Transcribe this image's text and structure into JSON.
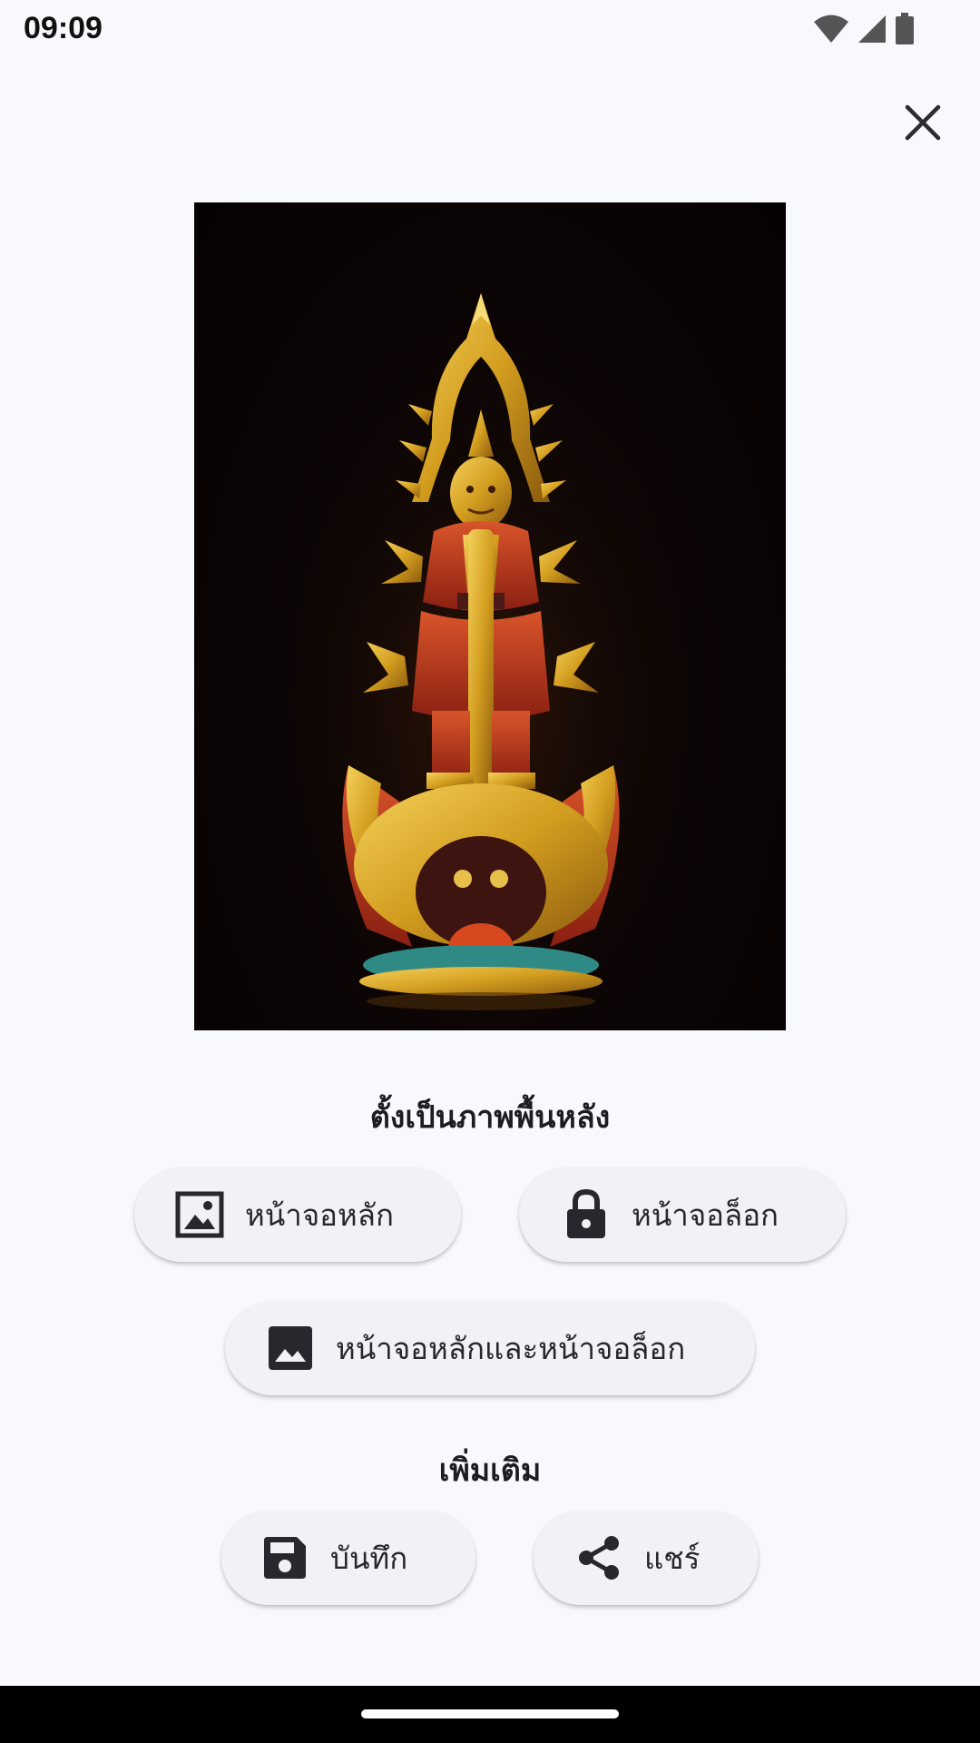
{
  "status_bar": {
    "time": "09:09",
    "icons": [
      "wifi-icon",
      "signal-icon",
      "battery-icon"
    ]
  },
  "header": {
    "close_icon": "close-icon"
  },
  "preview": {
    "description_icon": "wallpaper-preview-image"
  },
  "set_wallpaper": {
    "title": "ตั้งเป็นภาพพื้นหลัง",
    "home_screen_label": "หน้าจอหลัก",
    "lock_screen_label": "หน้าจอล็อก",
    "both_label": "หน้าจอหลักและหน้าจอล็อก"
  },
  "more": {
    "title": "เพิ่มเติม",
    "save_label": "บันทึก",
    "share_label": "แชร์"
  },
  "colors": {
    "background": "#f7f9fc",
    "button": "#f0f2f5",
    "icon": "#26282d",
    "gold": "#d9a826",
    "red": "#b8381c",
    "teal": "#2f8a86"
  }
}
